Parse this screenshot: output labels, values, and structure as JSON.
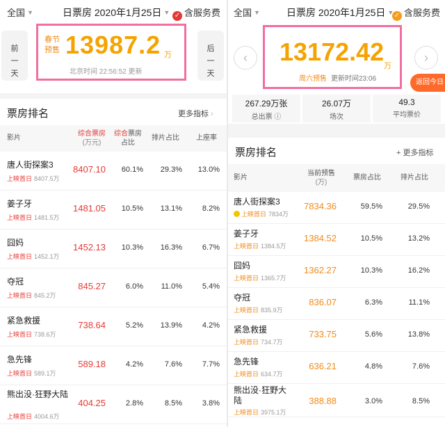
{
  "left": {
    "city": "全国",
    "date": "日票房  2020年1月25日",
    "service": "含服务费",
    "prev_day": [
      "前",
      "一",
      "天"
    ],
    "next_day": [
      "后",
      "一",
      "天"
    ],
    "tag_line1": "春节",
    "tag_line2": "预售",
    "total": "13987.2",
    "unit": "万",
    "time_text": "北京时间 22:56:52 更新",
    "section_title": "票房排名",
    "more": "更多指标",
    "headers": {
      "film": "影片",
      "box1": "综合票房",
      "box2": "(万元)",
      "share_red": "综合",
      "share_rest": "票房",
      "share2": "占比",
      "sched": "排片占比",
      "occ": "上座率"
    },
    "rows": [
      {
        "name": "唐人街探案3",
        "sub_prefix": "上映首日",
        "sub_value": "8407.5万",
        "box": "8407.10",
        "share": "60.1%",
        "sched": "29.3%",
        "occ": "13.0%"
      },
      {
        "name": "姜子牙",
        "sub_prefix": "上映首日",
        "sub_value": "1481.5万",
        "box": "1481.05",
        "share": "10.5%",
        "sched": "13.1%",
        "occ": "8.2%"
      },
      {
        "name": "囧妈",
        "sub_prefix": "上映首日",
        "sub_value": "1452.1万",
        "box": "1452.13",
        "share": "10.3%",
        "sched": "16.3%",
        "occ": "6.7%"
      },
      {
        "name": "夺冠",
        "sub_prefix": "上映首日",
        "sub_value": "845.2万",
        "box": "845.27",
        "share": "6.0%",
        "sched": "11.0%",
        "occ": "5.4%"
      },
      {
        "name": "紧急救援",
        "sub_prefix": "上映首日",
        "sub_value": "738.6万",
        "box": "738.64",
        "share": "5.2%",
        "sched": "13.9%",
        "occ": "4.2%"
      },
      {
        "name": "急先锋",
        "sub_prefix": "上映首日",
        "sub_value": "589.1万",
        "box": "589.18",
        "share": "4.2%",
        "sched": "7.6%",
        "occ": "7.7%"
      },
      {
        "name": "熊出没·狂野大陆",
        "sub_prefix": "上映首日",
        "sub_value": "4004.6万",
        "box": "404.25",
        "share": "2.8%",
        "sched": "8.5%",
        "occ": "3.8%"
      }
    ]
  },
  "right": {
    "city": "全国",
    "date": "日票房  2020年1月25日",
    "service": "含服务费",
    "total": "13172.42",
    "unit": "万",
    "tag": "周六预售",
    "time_text": "更新时间23:06",
    "back_today": "返回今日 >",
    "stats": [
      {
        "value": "267.29万张",
        "label": "总出票 ⓘ"
      },
      {
        "value": "26.07万",
        "label": "场次"
      },
      {
        "value": "49.3",
        "label": "平均票价"
      }
    ],
    "section_title": "票房排名",
    "more": "+ 更多指标",
    "headers": {
      "film": "影片",
      "box1": "当前预售",
      "box2": "(万)",
      "share": "票房占比",
      "sched": "排片占比"
    },
    "rows": [
      {
        "name": "唐人街探案3",
        "sub_prefix": "上映首日",
        "sub_value": "7834万",
        "box": "7834.36",
        "share": "59.5%",
        "sched": "29.5%",
        "crown": true
      },
      {
        "name": "姜子牙",
        "sub_prefix": "上映首日",
        "sub_value": "1384.5万",
        "box": "1384.52",
        "share": "10.5%",
        "sched": "13.2%"
      },
      {
        "name": "囧妈",
        "sub_prefix": "上映首日",
        "sub_value": "1365.7万",
        "box": "1362.27",
        "share": "10.3%",
        "sched": "16.2%"
      },
      {
        "name": "夺冠",
        "sub_prefix": "上映首日",
        "sub_value": "835.9万",
        "box": "836.07",
        "share": "6.3%",
        "sched": "11.1%"
      },
      {
        "name": "紧急救援",
        "sub_prefix": "上映首日",
        "sub_value": "734.7万",
        "box": "733.75",
        "share": "5.6%",
        "sched": "13.8%"
      },
      {
        "name": "急先锋",
        "sub_prefix": "上映首日",
        "sub_value": "634.7万",
        "box": "636.21",
        "share": "4.8%",
        "sched": "7.6%"
      },
      {
        "name": "熊出没·狂野大陆",
        "sub_prefix": "上映首日",
        "sub_value": "3975.1万",
        "box": "388.88",
        "share": "3.0%",
        "sched": "8.5%"
      }
    ]
  },
  "colors": {
    "red": "#e33a36",
    "orange": "#f08a18",
    "gold": "#f5a300",
    "pink_highlight": "#f06ea0"
  }
}
